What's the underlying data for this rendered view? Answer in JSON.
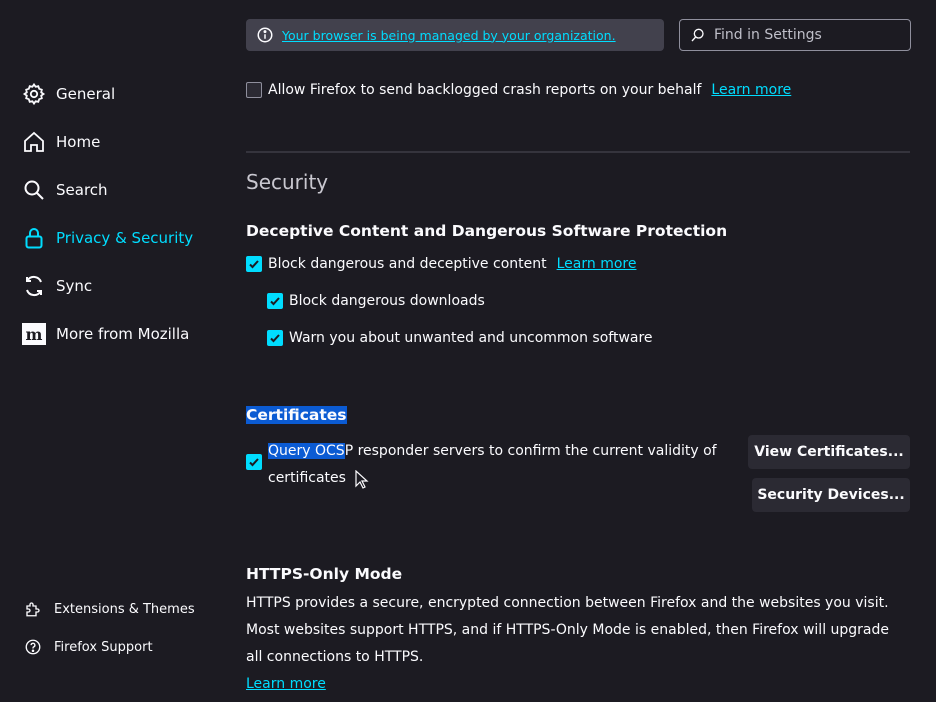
{
  "sidebar": {
    "items": [
      {
        "label": "General",
        "icon": "gear-icon"
      },
      {
        "label": "Home",
        "icon": "home-icon"
      },
      {
        "label": "Search",
        "icon": "search-icon"
      },
      {
        "label": "Privacy & Security",
        "icon": "lock-icon",
        "active": true
      },
      {
        "label": "Sync",
        "icon": "sync-icon"
      },
      {
        "label": "More from Mozilla",
        "icon": "mozilla-icon"
      }
    ],
    "footer": [
      {
        "label": "Extensions & Themes",
        "icon": "puzzle-icon"
      },
      {
        "label": "Firefox Support",
        "icon": "help-icon"
      }
    ]
  },
  "topbar": {
    "managed_text": "Your browser is being managed by your organization.",
    "search_placeholder": "Find in Settings"
  },
  "crash": {
    "label": "Allow Firefox to send backlogged crash reports on your behalf",
    "checked": false,
    "learn_more": "Learn more"
  },
  "security": {
    "title": "Security",
    "deceptive": {
      "heading": "Deceptive Content and Dangerous Software Protection",
      "block_label": "Block dangerous and deceptive content",
      "learn_more": "Learn more",
      "downloads_label": "Block dangerous downloads",
      "unwanted_label": "Warn you about unwanted and uncommon software"
    },
    "certificates": {
      "heading": "Certificates",
      "ocsp_highlight": "Query OCS",
      "ocsp_rest": "P responder servers to confirm the current validity of",
      "ocsp_line2": "certificates",
      "view_button": "View Certificates...",
      "devices_button": "Security Devices..."
    },
    "https_only": {
      "heading": "HTTPS-Only Mode",
      "description": "HTTPS provides a secure, encrypted connection between Firefox and the websites you visit. Most websites support HTTPS, and if HTTPS-Only Mode is enabled, then Firefox will upgrade all connections to HTTPS.",
      "learn_more": "Learn more"
    }
  },
  "colors": {
    "background": "#1c1b22",
    "accent": "#00ddff",
    "selection": "#0b5bd3"
  }
}
